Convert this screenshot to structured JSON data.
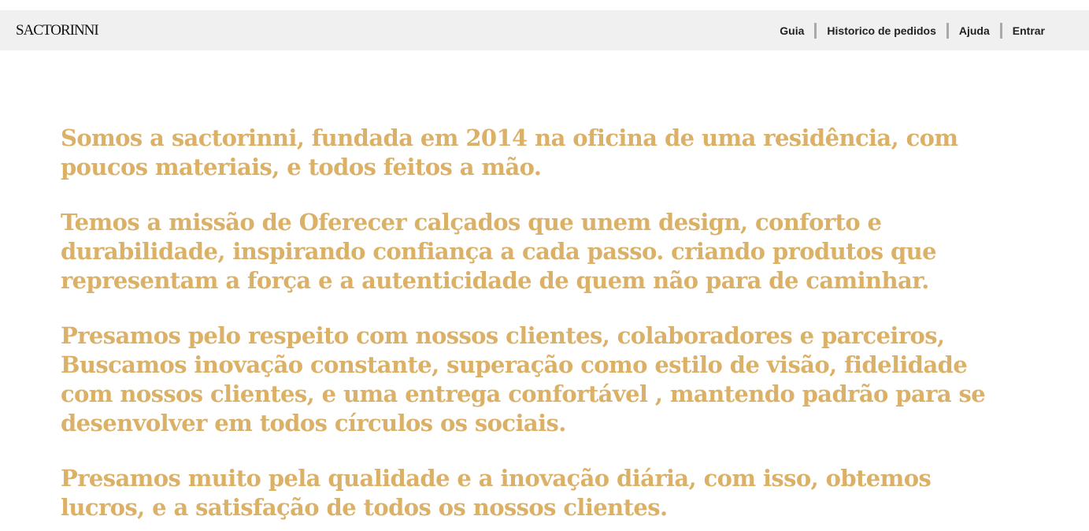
{
  "brand": {
    "logo_text": "SACTORINNI"
  },
  "nav": {
    "items": [
      {
        "label": "Guia"
      },
      {
        "label": "Historico de pedidos"
      },
      {
        "label": "Ajuda"
      },
      {
        "label": "Entrar"
      }
    ]
  },
  "about": {
    "paragraphs": [
      "Somos a sactorinni, fundada em 2014 na oficina de uma residência, com poucos materiais, e todos feitos a mão.",
      "Temos a missão de Oferecer calçados que unem design, conforto e durabilidade, inspirando confiança a cada passo. criando produtos que representam a força e a autenticidade de quem não para de caminhar.",
      "Presamos pelo respeito com nossos clientes, colaboradores e parceiros, Buscamos inovação constante, superação como estilo de visão, fidelidade com nossos clientes, e uma entrega confortável , mantendo padrão para se desenvolver em todos círculos os sociais.",
      "Presamos muito pela qualidade e a inovação diária, com isso, obtemos lucros, e a satisfação de todos os nossos clientes."
    ]
  },
  "colors": {
    "text_accent": "#dbb067",
    "navbar_bg": "#f0f0f0",
    "separator": "#a9a9a9"
  }
}
